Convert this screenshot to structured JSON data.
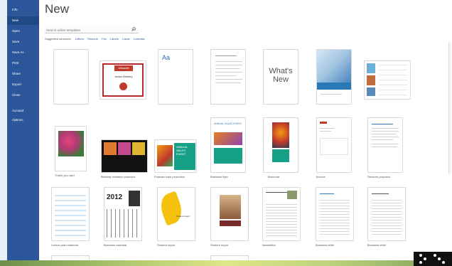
{
  "nav": {
    "items": [
      "Info",
      "New",
      "Open",
      "Save",
      "Save As",
      "Print",
      "Share",
      "Export",
      "Close",
      "Account",
      "Options"
    ]
  },
  "header": {
    "title": "New",
    "search_placeholder": "Search online templates",
    "suggested_label": "Suggested searches:",
    "suggested": [
      "Letters",
      "Resume",
      "Fax",
      "Labels",
      "Cards",
      "Calendar"
    ]
  },
  "templates": {
    "row1": [
      "",
      "",
      "",
      "",
      "What's New",
      "",
      ""
    ],
    "row2": [
      "Thank you card",
      "Birthday invitation postcard",
      "Postcard sale promotion",
      "Business flyer",
      "Brochure",
      "Invoice",
      "Services proposal"
    ],
    "row3": [
      "Lesson plan calendar",
      "Business calendar",
      "Student report",
      "Student report",
      "Newsletter",
      "Business letter",
      "Business letter"
    ],
    "card_title": "Adam Berkley",
    "card_badge": "Valuable",
    "aa": "Aa",
    "calendar_year": "2012",
    "flyer_heading": "ANNUAL SALES EVENT",
    "report_label": "Student report"
  },
  "colors": {
    "nav_bg": "#2b579a",
    "accent": "#2b579a"
  }
}
